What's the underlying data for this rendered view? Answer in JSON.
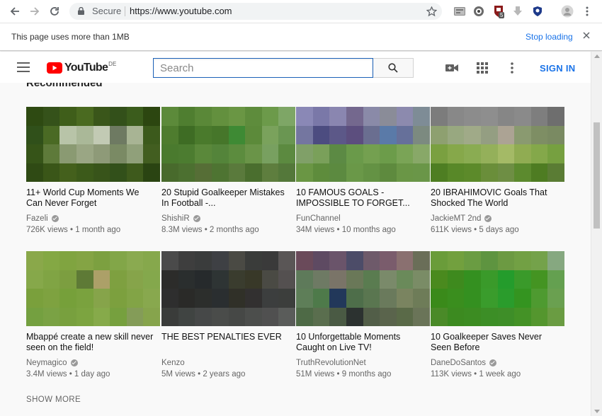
{
  "browser": {
    "secure_label": "Secure",
    "url": "https://www.youtube.com",
    "extension_badge": "5"
  },
  "infobar": {
    "message": "This page uses more than 1MB",
    "action_label": "Stop loading"
  },
  "youtube": {
    "logo_text": "YouTube",
    "country_code": "DE",
    "search_placeholder": "Search",
    "sign_in_label": "SIGN IN",
    "brand_color": "#ff0000",
    "link_color": "#1a73e8"
  },
  "section": {
    "title": "Recommended",
    "show_more": "SHOW MORE"
  },
  "videos": [
    {
      "title": "11+ World Cup Moments We Can Never Forget",
      "channel": "Fazeli",
      "verified": true,
      "meta": "726K views • 1 month ago",
      "thumb_colors": [
        "#2e4a12",
        "#35521a",
        "#3f5e1a",
        "#4a6a20",
        "#3a561a",
        "#33501a",
        "#3b5c1c",
        "#2c4610",
        "#30501a",
        "#4a6a24",
        "#b8c4a8",
        "#aab898",
        "#c2cab4",
        "#6e7a62",
        "#a8b494",
        "#3c5a1c",
        "#365418",
        "#5e7a3a",
        "#8a9a72",
        "#9aa684",
        "#8e9a78",
        "#7a8a64",
        "#90a07a",
        "#425e20",
        "#2f4a14",
        "#3a5618",
        "#44601c",
        "#3c5a1a",
        "#38541a",
        "#32501a",
        "#3e5a1c",
        "#2a4412"
      ]
    },
    {
      "title": "20 Stupid Goalkeeper Mistakes In Football -...",
      "channel": "ShishiR",
      "verified": true,
      "meta": "8.3M views • 2 months ago",
      "thumb_colors": [
        "#5c8a3a",
        "#4f7e30",
        "#5a8838",
        "#63903e",
        "#6a9644",
        "#5e8c3c",
        "#6c9a4a",
        "#7ea666",
        "#4e7c2e",
        "#3e6c24",
        "#4a7a2c",
        "#46762a",
        "#3e8a34",
        "#5c8a3a",
        "#7aa25c",
        "#6a9652",
        "#4a7a2e",
        "#4c7c30",
        "#5a883a",
        "#54843a",
        "#5c8c3e",
        "#6a9448",
        "#78a060",
        "#5c8a40",
        "#486a2c",
        "#4c7030",
        "#566e36",
        "#4e7432",
        "#5a7a3c",
        "#4a6e2e",
        "#5e7e3e",
        "#54783a"
      ]
    },
    {
      "title": "10 FAMOUS GOALS - IMPOSSIBLE TO FORGET...",
      "channel": "FunChannel",
      "verified": false,
      "meta": "34M views • 10 months ago",
      "thumb_colors": [
        "#8a88b6",
        "#7a78a8",
        "#8a86b0",
        "#74688e",
        "#8a8aa8",
        "#8a8c98",
        "#8c8aae",
        "#7e8c96",
        "#7476a0",
        "#4c4c80",
        "#5c5888",
        "#5c4e7e",
        "#6a6e90",
        "#5a7aa8",
        "#66709a",
        "#7c8a80",
        "#80a068",
        "#7aa05a",
        "#5c8a44",
        "#6a9a4a",
        "#74a050",
        "#6c9c4a",
        "#7aa456",
        "#88a868",
        "#6a9644",
        "#5e8c3c",
        "#5c8a40",
        "#6a9848",
        "#649244",
        "#5e8a3e",
        "#6a9646",
        "#6a9648"
      ]
    },
    {
      "title": "20 IBRAHIMOVIC Goals That Shocked The World",
      "channel": "JackieMT 2nd",
      "verified": true,
      "meta": "611K views • 5 days ago",
      "thumb_colors": [
        "#7c7c7c",
        "#888888",
        "#8c8c8c",
        "#8e8e8e",
        "#868686",
        "#8a8a8a",
        "#7e7e7e",
        "#6e6e6e",
        "#8ea070",
        "#98a880",
        "#a0aa88",
        "#949e82",
        "#aca394",
        "#8a9a70",
        "#7e8e64",
        "#7a8a62",
        "#7aa040",
        "#86a84a",
        "#8aac52",
        "#94b05a",
        "#a4ba66",
        "#90ac52",
        "#84a84a",
        "#76a040",
        "#4e7e22",
        "#588828",
        "#5c8a2a",
        "#6a8e3a",
        "#6e8e44",
        "#5c8a2e",
        "#4e7c22",
        "#5a7c34"
      ]
    },
    {
      "title": "Mbappé create a new skill never seen on the field!",
      "channel": "Neymagico",
      "verified": true,
      "meta": "3.4M views • 1 day ago",
      "thumb_colors": [
        "#8aa84a",
        "#84a844",
        "#80a440",
        "#84a444",
        "#7ca040",
        "#82a648",
        "#8aaa50",
        "#86a84c",
        "#86a84a",
        "#80a444",
        "#7c9e40",
        "#5e7a36",
        "#aca068",
        "#7ea040",
        "#86a44a",
        "#84a84c",
        "#7aa03c",
        "#7ea240",
        "#76a03a",
        "#7aa23e",
        "#86a44a",
        "#7ca03e",
        "#82a446",
        "#88a84e",
        "#74a040",
        "#7aa244",
        "#78a03e",
        "#7ca440",
        "#86aa4a",
        "#76a03e",
        "#849c58",
        "#86a44c"
      ]
    },
    {
      "title": "THE BEST PENALTIES EVER",
      "channel": "Kenzo",
      "verified": false,
      "meta": "5M views • 2 years ago",
      "thumb_colors": [
        "#4a4a4a",
        "#3e3e3e",
        "#3a3c3c",
        "#3e4044",
        "#4a4a44",
        "#3a3c3a",
        "#3a3a3a",
        "#5a5656",
        "#2c2c2a",
        "#2a2e2e",
        "#262a2c",
        "#2e3434",
        "#3a3c2e",
        "#383828",
        "#4a4a44",
        "#545050",
        "#2e2e2e",
        "#2a2a28",
        "#2c2e2c",
        "#2a2e30",
        "#303028",
        "#323030",
        "#3c3e3e",
        "#3c3e3c",
        "#3a3c3a",
        "#404442",
        "#464848",
        "#4a4c4a",
        "#464846",
        "#4c4e4c",
        "#505050",
        "#5a5c5a"
      ]
    },
    {
      "title": "10 Unforgettable Moments Caught on Live TV!",
      "channel": "TruthRevolutionNet",
      "verified": false,
      "meta": "51M views • 9 months ago",
      "thumb_colors": [
        "#6a4a5a",
        "#5e4a62",
        "#6a546a",
        "#4c4c68",
        "#6e5a6a",
        "#7a5c6c",
        "#8a7070",
        "#6a6e58",
        "#5e7a5a",
        "#6e7a64",
        "#7a7468",
        "#6a7858",
        "#5a7c50",
        "#7a8a6a",
        "#6a8a5a",
        "#7a8c66",
        "#5e7e58",
        "#4e7a4a",
        "#22385a",
        "#4e6e4a",
        "#5a7650",
        "#6a7a5c",
        "#7a8460",
        "#6e7c58",
        "#4e6a46",
        "#5a6e4e",
        "#4a5a44",
        "#2c3230",
        "#525e48",
        "#5a644c",
        "#5a6a48",
        "#6a7458"
      ]
    },
    {
      "title": "10 Goalkeeper Saves Never Seen Before",
      "channel": "DaneDoSantos",
      "verified": true,
      "meta": "113K views • 1 week ago",
      "thumb_colors": [
        "#6a9c3a",
        "#72a03e",
        "#6a9c42",
        "#5e9440",
        "#6c9a42",
        "#72a044",
        "#74a24a",
        "#86a880",
        "#4a8a1e",
        "#3e8a1e",
        "#349020",
        "#3a9a2a",
        "#249c2c",
        "#3a9a2a",
        "#449422",
        "#64a050",
        "#3a8a1a",
        "#3a8e1e",
        "#349020",
        "#3a9c2c",
        "#2a9c2c",
        "#349420",
        "#4e9a30",
        "#6aa050",
        "#4a8a28",
        "#3c8a20",
        "#3c8c22",
        "#3c8e26",
        "#3e8e28",
        "#449226",
        "#54962e",
        "#6a9c42"
      ]
    }
  ]
}
